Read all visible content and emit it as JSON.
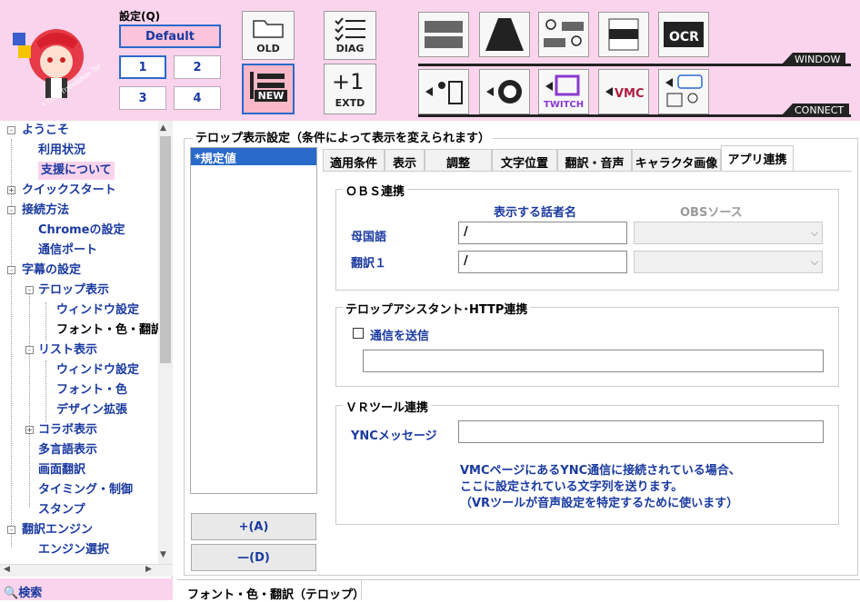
{
  "toolbar": {
    "preset_label": "設定(Q)",
    "default_label": "Default",
    "presets": [
      "1",
      "2",
      "3",
      "4"
    ],
    "tools": {
      "old": "OLD",
      "diag": "DIAG",
      "new": "NEW",
      "extd": "EXTD",
      "ocr": "OCR",
      "vmc": "VMC",
      "twitch": "TWITCH"
    },
    "window_tag": "WINDOW",
    "connect_tag": "CONNECT",
    "logo_text": "Real-Time Translation Tool"
  },
  "sidebar": {
    "items": [
      {
        "label": "ようこそ"
      },
      {
        "label": "利用状況"
      },
      {
        "label": "支援について"
      },
      {
        "label": "クイックスタート"
      },
      {
        "label": "接続方法"
      },
      {
        "label": "Chromeの設定"
      },
      {
        "label": "通信ポート"
      },
      {
        "label": "字幕の設定"
      },
      {
        "label": "テロップ表示"
      },
      {
        "label": "ウィンドウ設定"
      },
      {
        "label": "フォント・色・翻訳"
      },
      {
        "label": "リスト表示"
      },
      {
        "label": "ウィンドウ設定"
      },
      {
        "label": "フォント・色"
      },
      {
        "label": "デザイン拡張"
      },
      {
        "label": "コラボ表示"
      },
      {
        "label": "多言語表示"
      },
      {
        "label": "画面翻訳"
      },
      {
        "label": "タイミング・制御"
      },
      {
        "label": "スタンプ"
      },
      {
        "label": "翻訳エンジン"
      },
      {
        "label": "エンジン選択"
      }
    ],
    "search_label": "検索"
  },
  "main": {
    "group_title": "テロップ表示設定（条件によって表示を変えられます）",
    "list_selected": "*規定値",
    "add_button": "+(A)",
    "delete_button": "—(D)",
    "tabs": [
      "適用条件",
      "表示",
      "調整",
      "文字位置",
      "翻訳・音声",
      "キャラクタ画像",
      "アプリ連携"
    ],
    "obs": {
      "title": "ＯＢＳ連携",
      "col_speaker": "表示する話者名",
      "col_source": "OBSソース",
      "row1_label": "母国語",
      "row1_value": "/",
      "row2_label": "翻訳１",
      "row2_value": "/"
    },
    "http": {
      "title": "テロップアシスタント･HTTP連携",
      "checkbox_label": "通信を送信",
      "input_value": ""
    },
    "vr": {
      "title": "ＶＲツール連携",
      "ync_label": "YNCメッセージ",
      "ync_value": "",
      "note1": "VMCページにあるYNC通信に接続されている場合、",
      "note2": "ここに設定されている文字列を送ります。",
      "note3": "（VRツールが音声設定を特定するために使います）"
    }
  },
  "status": {
    "text": "フォント・色・翻訳（テロップ）"
  }
}
